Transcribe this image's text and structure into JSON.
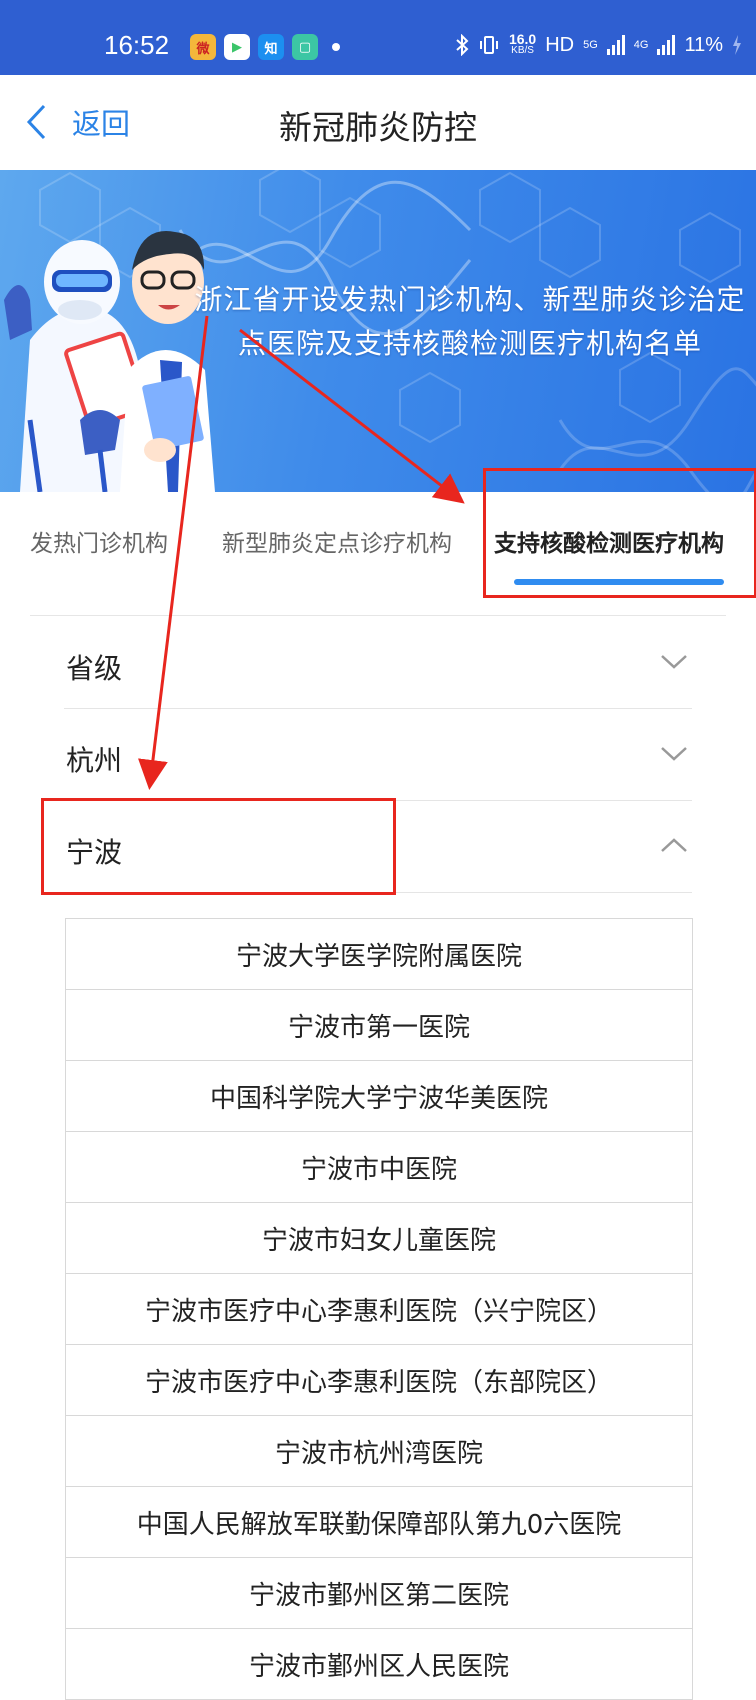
{
  "status_bar": {
    "time": "16:52",
    "apps": [
      {
        "name": "weibo-icon",
        "glyph": "微",
        "color": "#f0b33a"
      },
      {
        "name": "video-app-icon",
        "glyph": "▶",
        "color": "#3bc56a"
      },
      {
        "name": "zhihu-icon",
        "glyph": "知",
        "color": "#1c8ff0"
      },
      {
        "name": "green-app-icon",
        "glyph": "▢",
        "color": "#39c3a3"
      }
    ],
    "net_speed": "16.0",
    "net_unit": "KB/S",
    "hd_label": "HD",
    "sig1_label": "5G",
    "sig2_label": "4G",
    "battery": "11%"
  },
  "nav": {
    "back_label": "返回",
    "title": "新冠肺炎防控"
  },
  "banner": {
    "title_line1": "浙江省开设发热门诊机构、新型肺炎诊治定",
    "title_line2": "点医院及支持核酸检测医疗机构名单"
  },
  "tabs": [
    {
      "label": "发热门诊机构",
      "active": false
    },
    {
      "label": "新型肺炎定点诊疗机构",
      "active": false
    },
    {
      "label": "支持核酸检测医疗机构",
      "active": true
    }
  ],
  "sections": [
    {
      "label": "省级",
      "expanded": false
    },
    {
      "label": "杭州",
      "expanded": false
    },
    {
      "label": "宁波",
      "expanded": true
    }
  ],
  "hospitals": [
    "宁波大学医学院附属医院",
    "宁波市第一医院",
    "中国科学院大学宁波华美医院",
    "宁波市中医院",
    "宁波市妇女儿童医院",
    "宁波市医疗中心李惠利医院（兴宁院区）",
    "宁波市医疗中心李惠利医院（东部院区）",
    "宁波市杭州湾医院",
    "中国人民解放军联勤保障部队第九0六医院",
    "宁波市鄞州区第二医院",
    "宁波市鄞州区人民医院"
  ],
  "colors": {
    "status_bar": "#2f5fd1",
    "accent": "#2f8cf0",
    "annotation": "#e8261e"
  }
}
